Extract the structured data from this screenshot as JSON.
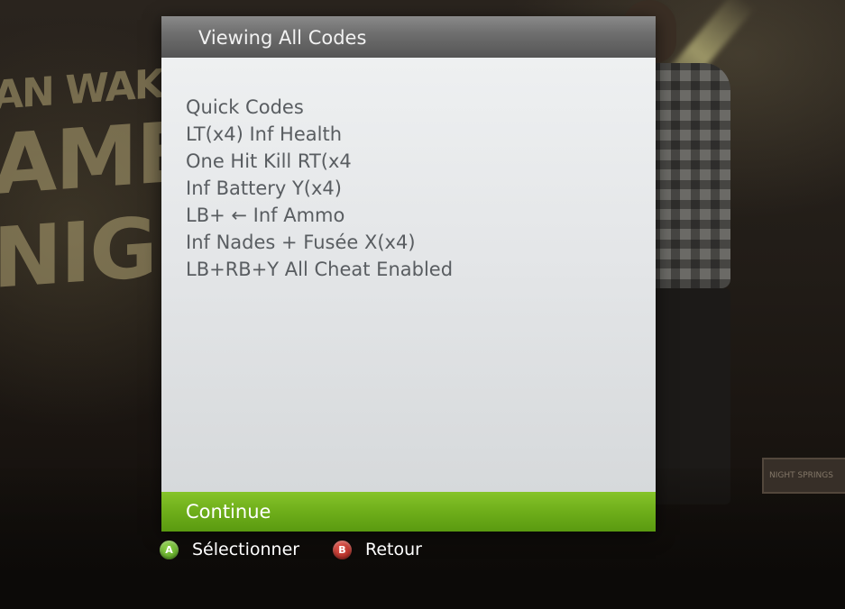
{
  "background": {
    "title_lines": [
      "AN WAKE'S",
      "AMER",
      "NIGH"
    ],
    "sign_text": "NIGHT SPRINGS"
  },
  "dialog": {
    "title": "Viewing All Codes",
    "lines": [
      "Quick Codes",
      "LT(x4) Inf Health",
      "One Hit Kill RT(x4",
      "Inf Battery Y(x4)",
      "LB+ ← Inf Ammo",
      "Inf Nades + Fusée X(x4)",
      "LB+RB+Y All Cheat Enabled"
    ],
    "continue_label": "Continue"
  },
  "hints": {
    "a": {
      "glyph": "A",
      "label": "Sélectionner",
      "color": "#5aa82a"
    },
    "b": {
      "glyph": "B",
      "label": "Retour",
      "color": "#b02a22"
    }
  },
  "colors": {
    "accent_green": "#6eae1a",
    "header_gray": "#6f6f6f",
    "body_text": "#595d61"
  }
}
